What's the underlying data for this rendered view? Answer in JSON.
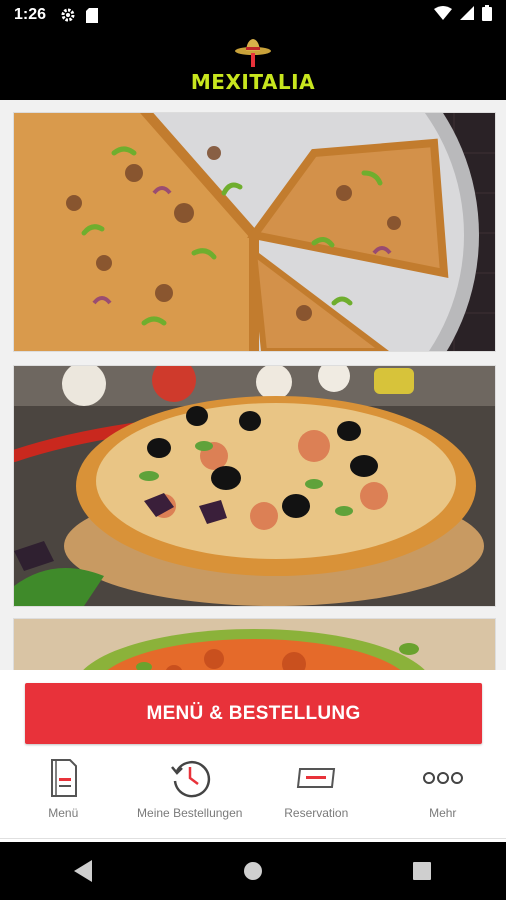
{
  "status_bar": {
    "time": "1:26",
    "icons": [
      "settings-gear-icon",
      "sd-card-icon",
      "wifi-icon",
      "signal-icon",
      "battery-icon"
    ]
  },
  "app_bar": {
    "logo_text": "MEXITALIA",
    "logo_color": "#c8e61e"
  },
  "gallery": {
    "items": [
      {
        "name": "pizza-minced-meat-peppers-image",
        "description_icon": "pizza-image"
      },
      {
        "name": "pizza-olives-basil-image",
        "description_icon": "pizza-image"
      },
      {
        "name": "pizza-partial-image",
        "description_icon": "pizza-image"
      }
    ]
  },
  "order_button": {
    "label": "MENÜ & BESTELLUNG",
    "color": "#e8323a"
  },
  "tabs": [
    {
      "label": "Menü",
      "icon": "menu-card-icon"
    },
    {
      "label": "Meine Bestellungen",
      "icon": "order-history-icon"
    },
    {
      "label": "Reservation",
      "icon": "reservation-ticket-icon"
    },
    {
      "label": "Mehr",
      "icon": "more-dots-icon"
    }
  ],
  "nav_bar": {
    "buttons": [
      "back-icon",
      "home-icon",
      "recents-icon"
    ]
  }
}
